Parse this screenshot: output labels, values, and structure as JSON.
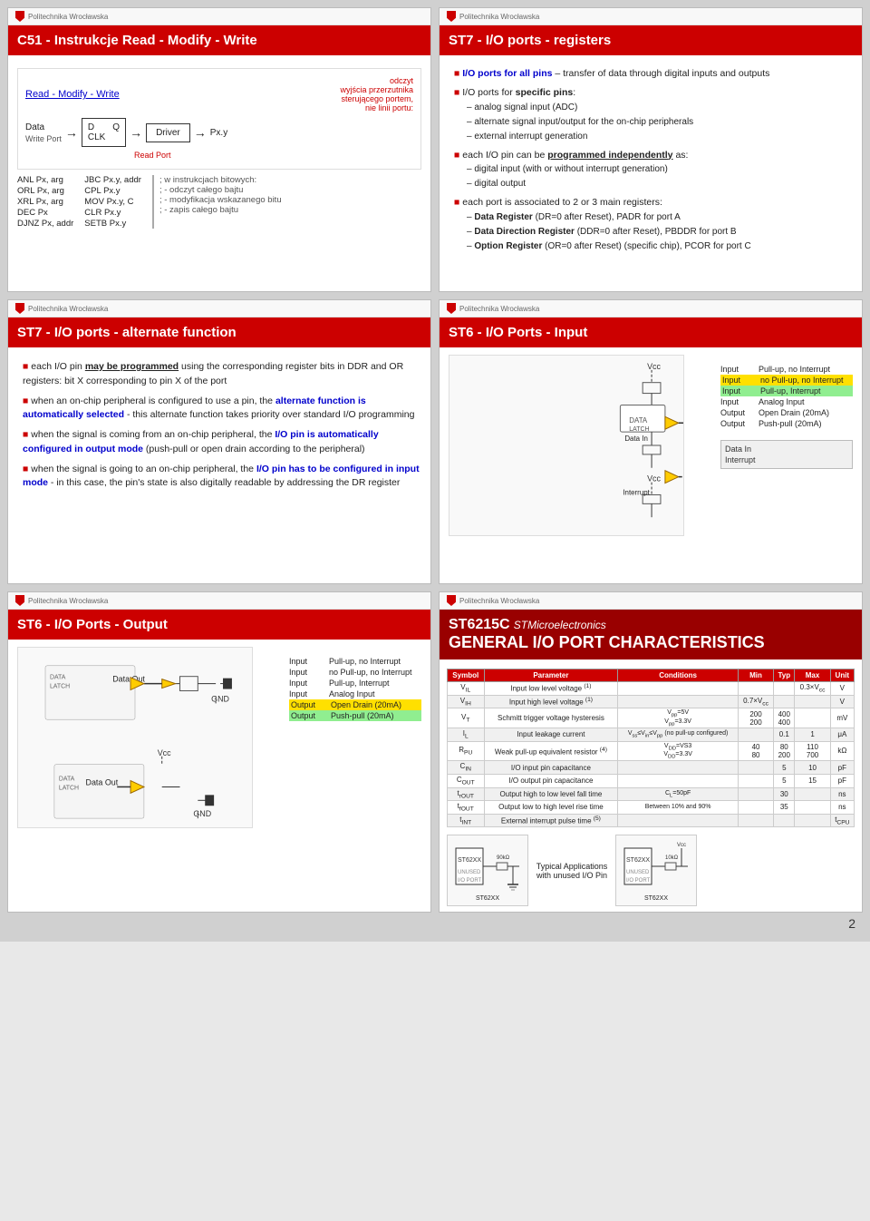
{
  "page": {
    "number": "2",
    "background": "#d0d0d0"
  },
  "slides": {
    "s1": {
      "uni": "Politechnika Wrocławska",
      "title": "C51 - Instrukcje Read - Modify - Write",
      "diagram_title": "Read - Modify - Write",
      "label_data": "Data",
      "label_write_port": "Write Port",
      "label_read_port": "Read Port",
      "label_d": "D",
      "label_q": "Q",
      "label_clk": "CLK",
      "label_driver": "Driver",
      "label_pxy": "Px.y",
      "note_red1": "odczyt",
      "note_red2": "wyjścia przerzutnika",
      "note_red3": "sterującego portem,",
      "note_red4": "nie linii portu:",
      "instructions": [
        {
          "mnem": "ANL",
          "args": "Px, arg"
        },
        {
          "mnem": "ORL",
          "args": "Px, arg"
        },
        {
          "mnem": "XRL",
          "args": "Px, arg"
        },
        {
          "mnem": "DEC",
          "args": "Px"
        },
        {
          "mnem": "DJNZ",
          "args": "Px, addr"
        }
      ],
      "instructions2": [
        {
          "mnem": "JBC",
          "args": "Px.y, addr"
        },
        {
          "mnem": "CPL",
          "args": "Px.y"
        },
        {
          "mnem": "MOV",
          "args": "Px.y, C"
        },
        {
          "mnem": "CLR",
          "args": "Px.y"
        },
        {
          "mnem": "SETB",
          "args": "Px.y"
        }
      ],
      "comments": [
        "; w instrukcjach bitowych:",
        "; - odczyt całego bajtu",
        "; - modyfikacja wskazanego bitu",
        "; - zapis całego bajtu"
      ]
    },
    "s2": {
      "uni": "Politechnika Wrocławska",
      "title": "ST7 - I/O ports - registers",
      "bullet1": "I/O ports for all pins",
      "bullet1_rest": " – transfer of data through digital inputs and outputs",
      "bullet2_pre": "I/O ports for ",
      "bullet2_bold": "specific pins",
      "bullet2_rest": ":",
      "sub2_1": "analog signal input (ADC)",
      "sub2_2": "alternate signal input/output for the on-chip peripherals",
      "sub2_3": "external interrupt generation",
      "bullet3_pre": "each I/O pin can be ",
      "bullet3_bold": "programmed independently",
      "bullet3_rest": " as:",
      "sub3_1": "digital input (with or without interrupt generation)",
      "sub3_2": "digital output",
      "bullet4": "each port is associated to 2 or 3 main registers:",
      "sub4_1_bold": "Data Register",
      "sub4_1_rest": " (DR=0 after Reset), PADR for port A",
      "sub4_2_bold": "Data Direction Register",
      "sub4_2_rest": " (DDR=0 after Reset), PBDDR for port B",
      "sub4_3_bold": "Option Register",
      "sub4_3_rest": " (OR=0 after Reset) (specific chip), PCOR for port C"
    },
    "s3": {
      "uni": "Politechnika Wrocławska",
      "title": "ST7 - I/O ports - alternate function",
      "b1_pre": "each I/O pin ",
      "b1_bold": "may be programmed",
      "b1_rest": " using the corresponding register bits in DDR and OR registers: bit X corresponding to pin X of the port",
      "b2_pre": "when an on-chip peripheral is configured to use a pin, the ",
      "b2_bold": "alternate function is automatically selected",
      "b2_rest": " - this alternate function takes priority over standard I/O programming",
      "b3_pre": "when the signal is coming from an on-chip peripheral, the ",
      "b3_bold": "I/O pin is automatically configured in output mode",
      "b3_rest": " (push-pull or open drain according to the peripheral)",
      "b4_pre": "when the signal is going to an on-chip peripheral, the ",
      "b4_bold": "I/O pin has to be configured in input mode",
      "b4_rest": " - in this case, the pin's state is also digitally readable by addressing the DR register"
    },
    "s4": {
      "uni": "Politechnika Wrocławska",
      "title": "ST6 - I/O Ports - Input",
      "vcc1": "Vcc",
      "vcc2": "Vcc",
      "data_in": "Data In",
      "interrupt": "Interrupt",
      "io_rows": [
        {
          "col1": "Input",
          "col2": "Pull-up, no Interrupt",
          "color": ""
        },
        {
          "col1": "Input",
          "col2": "no Pull-up, no Interrupt",
          "color": "yellow"
        },
        {
          "col1": "Input",
          "col2": "Pull-up, Interrupt",
          "color": "green"
        },
        {
          "col1": "Input",
          "col2": "Analog Input",
          "color": ""
        },
        {
          "col1": "Output",
          "col2": "Open Drain (20mA)",
          "color": ""
        },
        {
          "col1": "Output",
          "col2": "Push-pull  (20mA)",
          "color": ""
        }
      ]
    },
    "s5": {
      "uni": "Politechnika Wrocławska",
      "title": "ST6 - I/O Ports - Output",
      "data_out1": "Data Out",
      "gnd1": "GND",
      "vcc": "Vcc",
      "data_out2": "Data Out",
      "gnd2": "GND",
      "io_rows": [
        {
          "col1": "Input",
          "col2": "Pull-up, no Interrupt"
        },
        {
          "col1": "Input",
          "col2": "no Pull-up, no Interrupt"
        },
        {
          "col1": "Input",
          "col2": "Pull-up, Interrupt"
        },
        {
          "col1": "Input",
          "col2": "Analog Input"
        },
        {
          "col1": "Output",
          "col2": "Open Drain (20mA)",
          "highlight": "yellow"
        },
        {
          "col1": "Output",
          "col2": "Push-pull (20mA)",
          "highlight": "green"
        }
      ]
    },
    "s6": {
      "uni": "Politechnika Wrocławska",
      "title_bold": "ST6215C",
      "title_italic": " STMicroelectronics",
      "title2": "General I/O PORT CHARACTERISTICS",
      "table_headers": [
        "Symbol",
        "Parameter",
        "Conditions",
        "Min",
        "Typ",
        "Max",
        "Unit"
      ],
      "table_rows": [
        [
          "V_IL",
          "Input low level voltage (1)",
          "",
          "",
          "",
          "0.3×Vcc",
          "V"
        ],
        [
          "V_IH",
          "Input high level voltage (1)",
          "",
          "0.7×Vcc",
          "",
          "",
          "V"
        ],
        [
          "V_T",
          "Schmitt trigger voltage hysteresis",
          "Vpp=5V\nVpp=3.3V",
          "200\n200",
          "400\n400",
          "",
          "mV"
        ],
        [
          "I_L",
          "Input leakage current",
          "Vss≤Vin≤Vpp (no pull-up configured)",
          "",
          "0.1",
          "1",
          "μA"
        ],
        [
          "R_PU",
          "Weak pull-up equivalent resistor (4)",
          "VDD=VS3\nVDD=3.3V",
          "40\n80",
          "80\n200",
          "110\n700",
          "kΩ"
        ],
        [
          "C_IN",
          "I/O input pin capacitance",
          "",
          "",
          "5",
          "10",
          "pF"
        ],
        [
          "C_OUT",
          "I/O output pin capacitance",
          "",
          "",
          "5",
          "15",
          "pF"
        ],
        [
          "t_rOUT",
          "Output high to low level fall time",
          "CL=50pF",
          "",
          "30",
          "",
          "ns"
        ],
        [
          "t_fOUT",
          "Output low to high level rise time",
          "Between 10% and 90%",
          "",
          "35",
          "",
          "ns"
        ],
        [
          "t_INT",
          "External interrupt pulse time (5)",
          "",
          "",
          "",
          "",
          "tCPU"
        ]
      ],
      "typical_app_label": "Typical Applications with unused I/O Pin",
      "chip_label": "ST62XX",
      "unused_label": "UNUSED I/O PORT",
      "unused_label2": "UNUSED I/O PORT"
    }
  }
}
